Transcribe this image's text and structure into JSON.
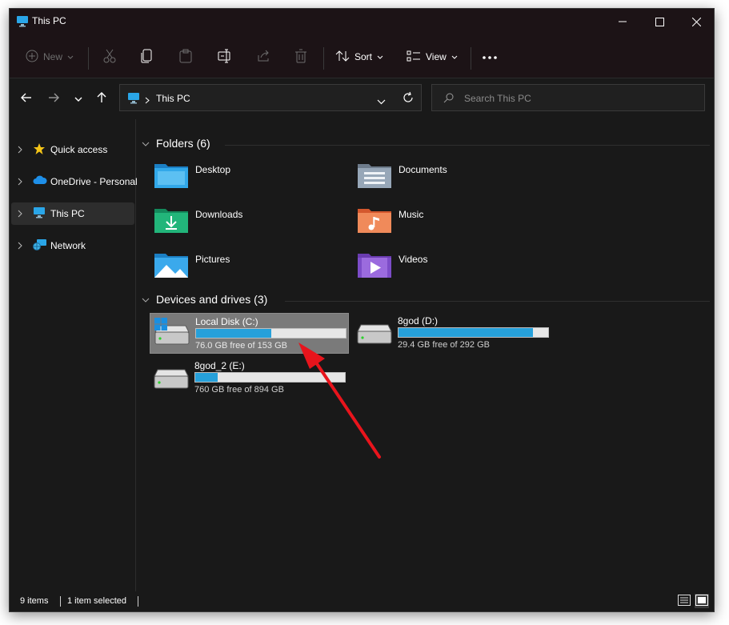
{
  "window": {
    "title": "This PC"
  },
  "commandbar": {
    "new_label": "New",
    "sort_label": "Sort",
    "view_label": "View"
  },
  "addressbar": {
    "path": "This PC",
    "search_placeholder": "Search This PC"
  },
  "sidebar": {
    "items": [
      {
        "label": "Quick access",
        "icon": "star-icon"
      },
      {
        "label": "OneDrive - Personal",
        "icon": "cloud-icon"
      },
      {
        "label": "This PC",
        "icon": "monitor-icon",
        "selected": true
      },
      {
        "label": "Network",
        "icon": "network-icon"
      }
    ]
  },
  "folders": {
    "header": "Folders (6)",
    "items": [
      {
        "name": "Desktop",
        "icon": "desktop-folder-icon"
      },
      {
        "name": "Documents",
        "icon": "documents-folder-icon"
      },
      {
        "name": "Downloads",
        "icon": "downloads-folder-icon"
      },
      {
        "name": "Music",
        "icon": "music-folder-icon"
      },
      {
        "name": "Pictures",
        "icon": "pictures-folder-icon"
      },
      {
        "name": "Videos",
        "icon": "videos-folder-icon"
      }
    ]
  },
  "drives": {
    "header": "Devices and drives (3)",
    "items": [
      {
        "name": "Local Disk (C:)",
        "free_text": "76.0 GB free of 153 GB",
        "used_fraction": 0.5,
        "selected": true
      },
      {
        "name": "8god (D:)",
        "free_text": "29.4 GB free of 292 GB",
        "used_fraction": 0.9,
        "selected": false
      },
      {
        "name": "8god_2 (E:)",
        "free_text": "760 GB free of 894 GB",
        "used_fraction": 0.15,
        "selected": false
      }
    ]
  },
  "statusbar": {
    "items_count": "9 items",
    "selection": "1 item selected"
  },
  "colors": {
    "accent": "#26a0da",
    "annotation_arrow": "#e8141c"
  }
}
